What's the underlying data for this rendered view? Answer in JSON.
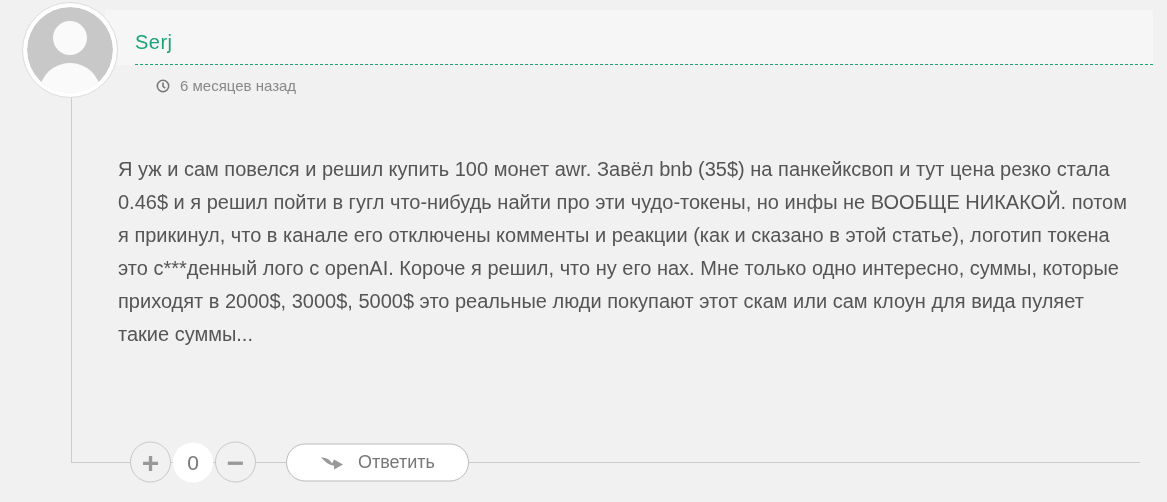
{
  "comment": {
    "author": "Serj",
    "time": "6 месяцев назад",
    "text": "Я уж и сам повелся и решил купить 100 монет awr. Завёл bnb (35$) на панкейксвоп и тут цена резко стала 0.46$ и я решил пойти в гугл что-нибудь найти про эти чудо-токены, но инфы не ВООБЩЕ НИКАКОЙ. потом я прикинул, что в канале его отключены комменты и реакции (как и сказано в этой статье), логотип токена это с***денный лого с openAI. Короче я решил, что ну его нах. Мне только одно интересно, суммы, которые приходят в 2000$, 3000$, 5000$ это реальные люди покупают этот скам или сам клоун для вида пуляет такие суммы...",
    "votes": {
      "up": "+",
      "count": "0",
      "down": "−"
    },
    "reply": "Ответить"
  }
}
